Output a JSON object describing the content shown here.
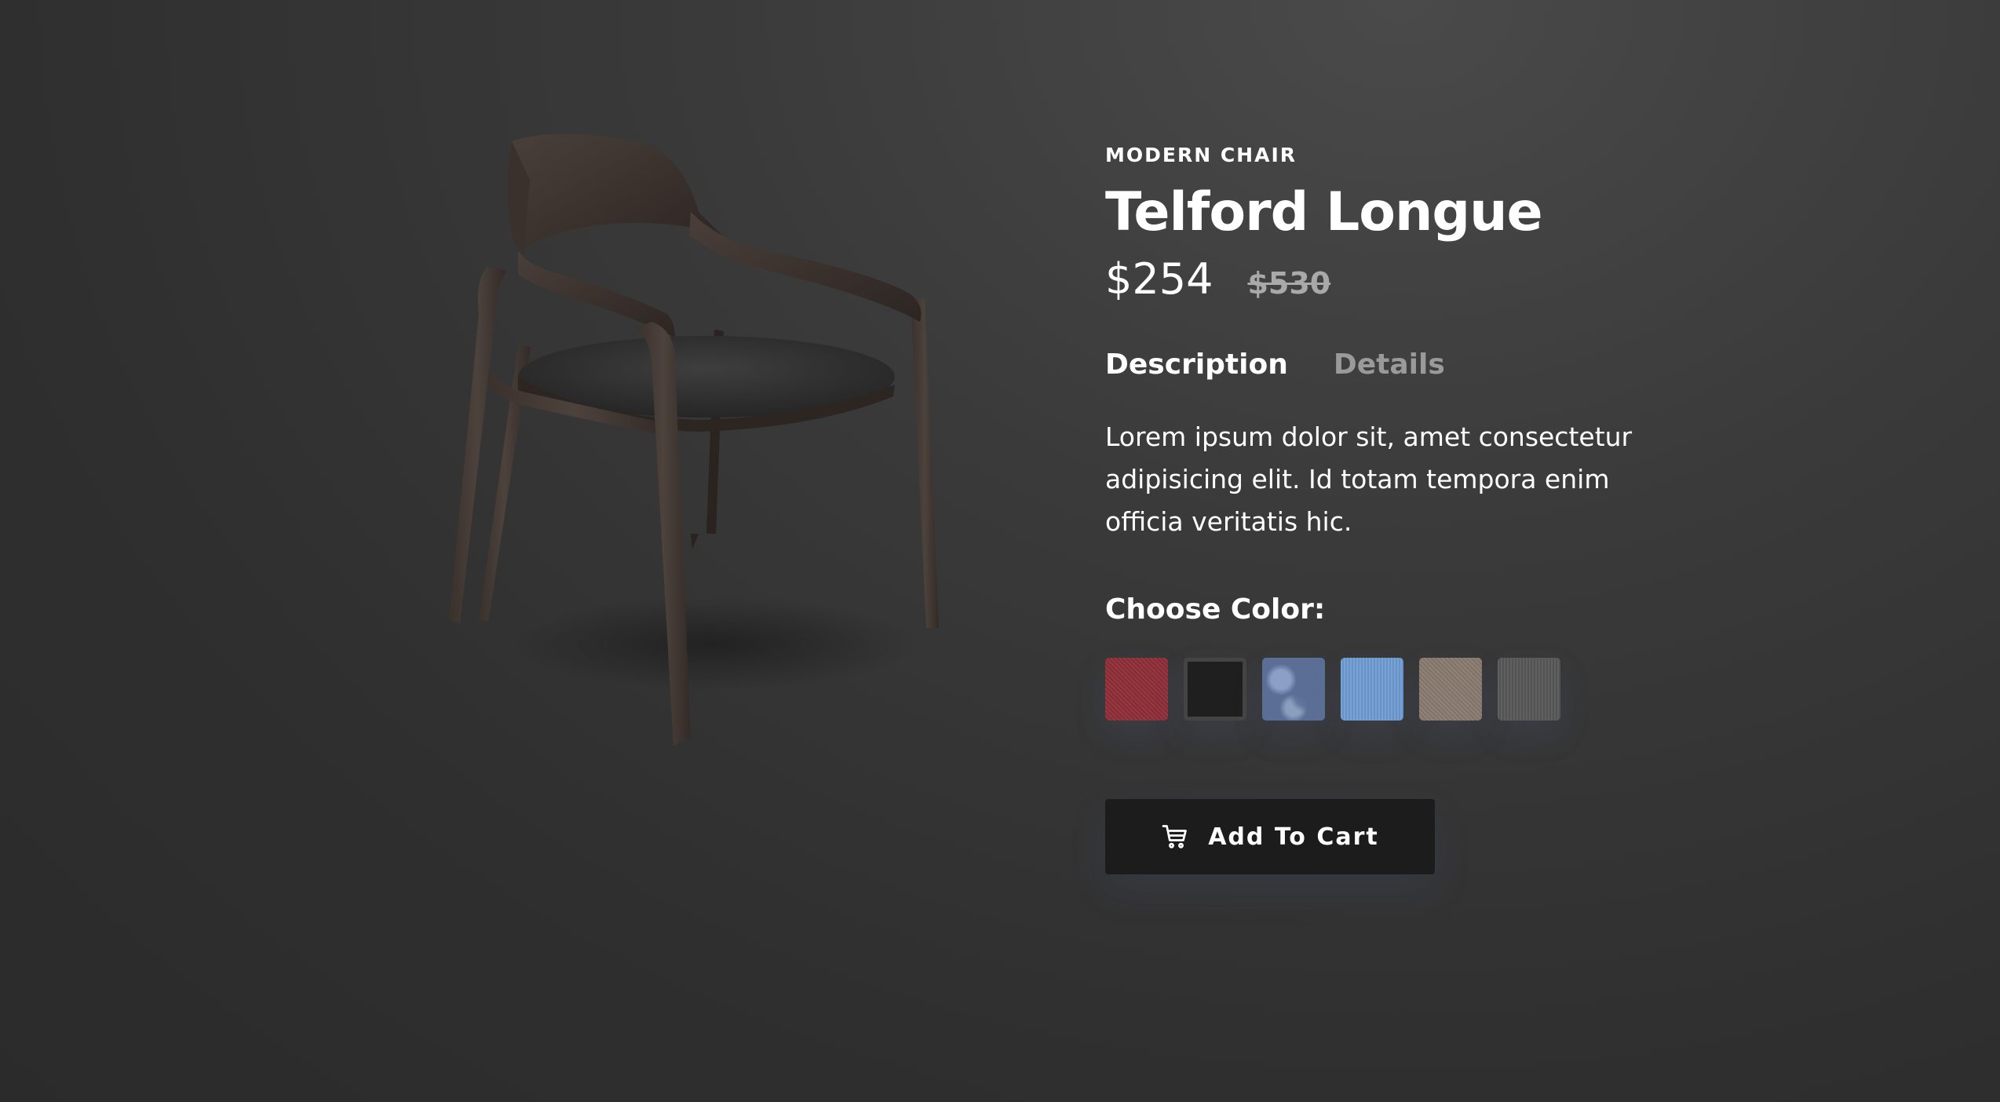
{
  "product": {
    "category": "MODERN CHAIR",
    "name": "Telford Longue",
    "price": "$254",
    "old_price": "$530",
    "image_icon": "chair-image"
  },
  "tabs": [
    {
      "label": "Description",
      "active": true
    },
    {
      "label": "Details",
      "active": false
    }
  ],
  "description": "Lorem ipsum dolor sit, amet consectetur adipisicing elit. Id totam tempora enim officia veritatis hic.",
  "color_picker": {
    "label": "Choose Color:",
    "options": [
      {
        "name": "red",
        "color": "#8e2e38",
        "selected": false
      },
      {
        "name": "black",
        "color": "#1f1f1f",
        "selected": true
      },
      {
        "name": "denim",
        "color": "#5b6f96",
        "selected": false
      },
      {
        "name": "light-blue",
        "color": "#6e9bd2",
        "selected": false
      },
      {
        "name": "beige",
        "color": "#8a7a70",
        "selected": false
      },
      {
        "name": "grey",
        "color": "#585858",
        "selected": false
      }
    ]
  },
  "cart_button": {
    "label": "Add To Cart",
    "icon": "cart-icon"
  }
}
